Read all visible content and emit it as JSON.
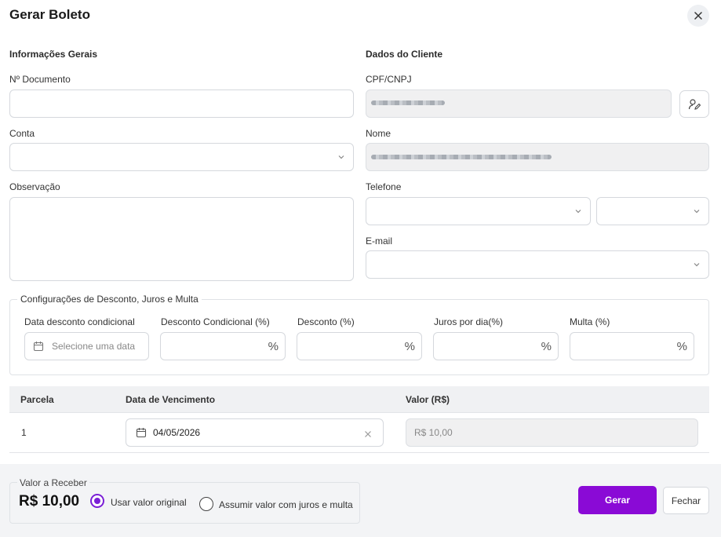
{
  "modal": {
    "title": "Gerar Boleto",
    "close_icon": "close-icon"
  },
  "general": {
    "section_title": "Informações Gerais",
    "documento_label": "Nº Documento",
    "documento_value": "",
    "conta_label": "Conta",
    "conta_value": "",
    "observacao_label": "Observação",
    "observacao_value": ""
  },
  "cliente": {
    "section_title": "Dados do Cliente",
    "cpf_label": "CPF/CNPJ",
    "nome_label": "Nome",
    "telefone_label": "Telefone",
    "email_label": "E-mail",
    "edit_icon": "edit-user-icon"
  },
  "descontos": {
    "legend": "Configurações de Desconto, Juros e Multa",
    "fields": [
      {
        "label": "Data desconto condicional",
        "placeholder": "Selecione uma data",
        "suffix": ""
      },
      {
        "label": "Desconto Condicional (%)",
        "placeholder": "",
        "suffix": "%"
      },
      {
        "label": "Desconto (%)",
        "placeholder": "",
        "suffix": "%"
      },
      {
        "label": "Juros por dia(%)",
        "placeholder": "",
        "suffix": "%"
      },
      {
        "label": "Multa (%)",
        "placeholder": "",
        "suffix": "%"
      }
    ]
  },
  "parcelas": {
    "headers": [
      "Parcela",
      "Data de Vencimento",
      "Valor (R$)"
    ],
    "rows": [
      {
        "parcela": "1",
        "vencimento": "04/05/2026",
        "valor": "R$ 10,00"
      }
    ]
  },
  "footer": {
    "valor_legend": "Valor a Receber",
    "valor_amount": "R$ 10,00",
    "radio_original": "Usar valor original",
    "radio_juros": "Assumir valor com juros e multa",
    "gerar_label": "Gerar",
    "fechar_label": "Fechar"
  },
  "colors": {
    "accent": "#8a0ad6",
    "disabled_bg": "#f0f0f1",
    "footer_bg": "#f3f4f6"
  }
}
